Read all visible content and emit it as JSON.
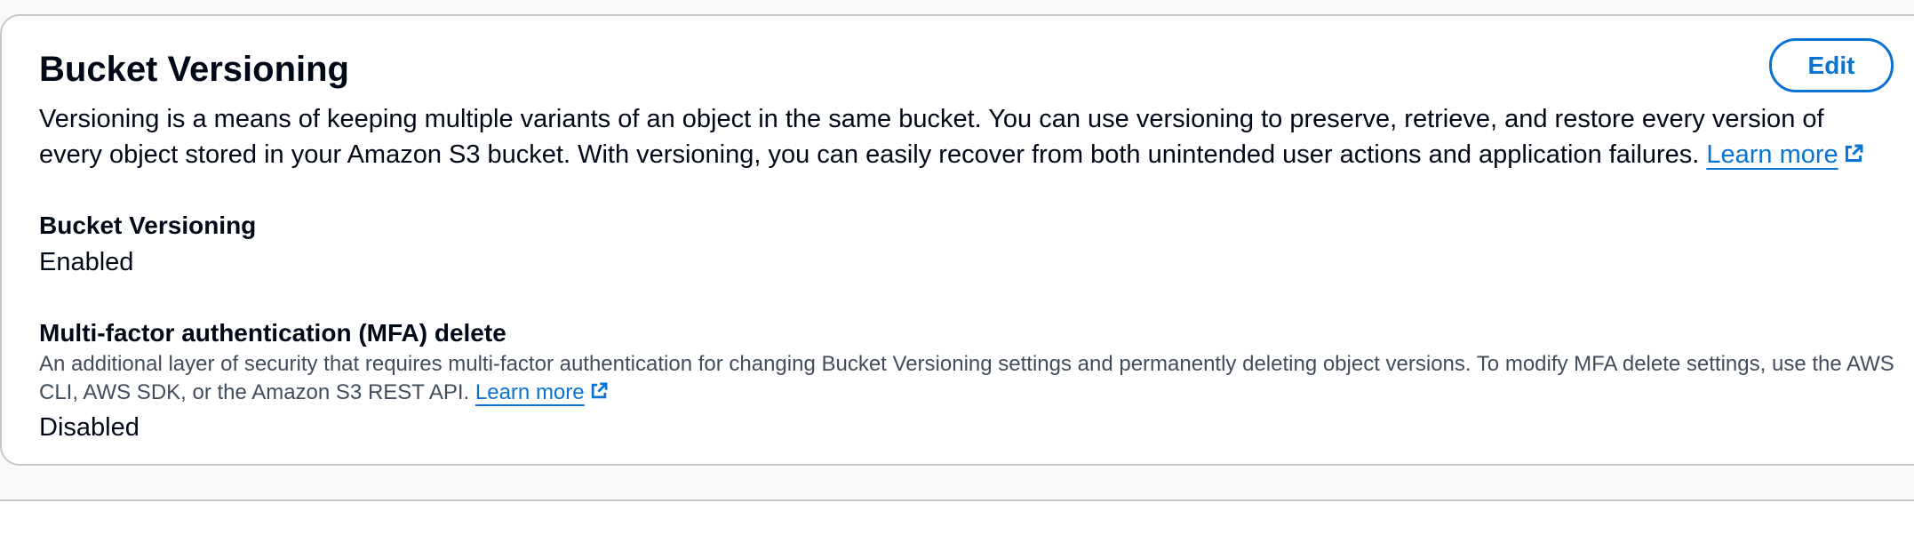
{
  "panel": {
    "title": "Bucket Versioning",
    "edit_label": "Edit",
    "description": "Versioning is a means of keeping multiple variants of an object in the same bucket. You can use versioning to preserve, retrieve, and restore every version of every object stored in your Amazon S3 bucket. With versioning, you can easily recover from both unintended user actions and application failures.",
    "description_link": "Learn more"
  },
  "fields": {
    "versioning": {
      "label": "Bucket Versioning",
      "value": "Enabled"
    },
    "mfa_delete": {
      "label": "Multi-factor authentication (MFA) delete",
      "help": "An additional layer of security that requires multi-factor authentication for changing Bucket Versioning settings and permanently deleting object versions. To modify MFA delete settings, use the AWS CLI, AWS SDK, or the Amazon S3 REST API.",
      "help_link": "Learn more",
      "value": "Disabled"
    }
  },
  "icons": {
    "external_link": "external-link-icon"
  },
  "colors": {
    "link": "#0972d3",
    "text": "#000716",
    "secondary_text": "#414d5c",
    "border": "#c6c6cd"
  }
}
